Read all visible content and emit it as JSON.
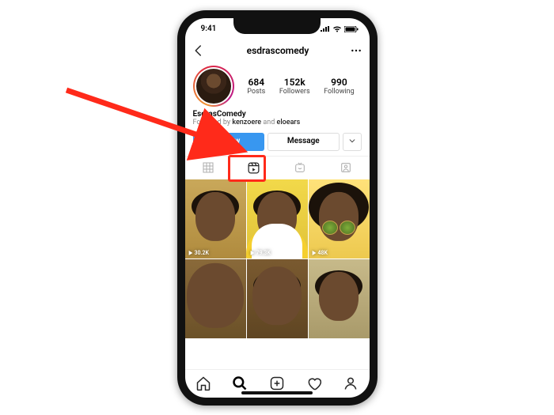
{
  "statusbar": {
    "time": "9:41"
  },
  "header": {
    "username": "esdrascomedy"
  },
  "profile": {
    "stats": {
      "posts": {
        "count": "684",
        "label": "Posts"
      },
      "followers": {
        "count": "152k",
        "label": "Followers"
      },
      "following": {
        "count": "990",
        "label": "Following"
      }
    },
    "display_name": "EsdrasComedy",
    "followed_by_prefix": "Followed by ",
    "followed_by_1": "kenzoere",
    "followed_by_sep": " and ",
    "followed_by_2": "eloears"
  },
  "actions": {
    "follow": "Follow",
    "message": "Message"
  },
  "reels": {
    "items": [
      {
        "plays": "30.2K"
      },
      {
        "plays": "79.3K"
      },
      {
        "plays": "48K"
      },
      {
        "plays": ""
      },
      {
        "plays": ""
      },
      {
        "plays": ""
      }
    ]
  },
  "annotation": {
    "target": "reels-tab"
  }
}
